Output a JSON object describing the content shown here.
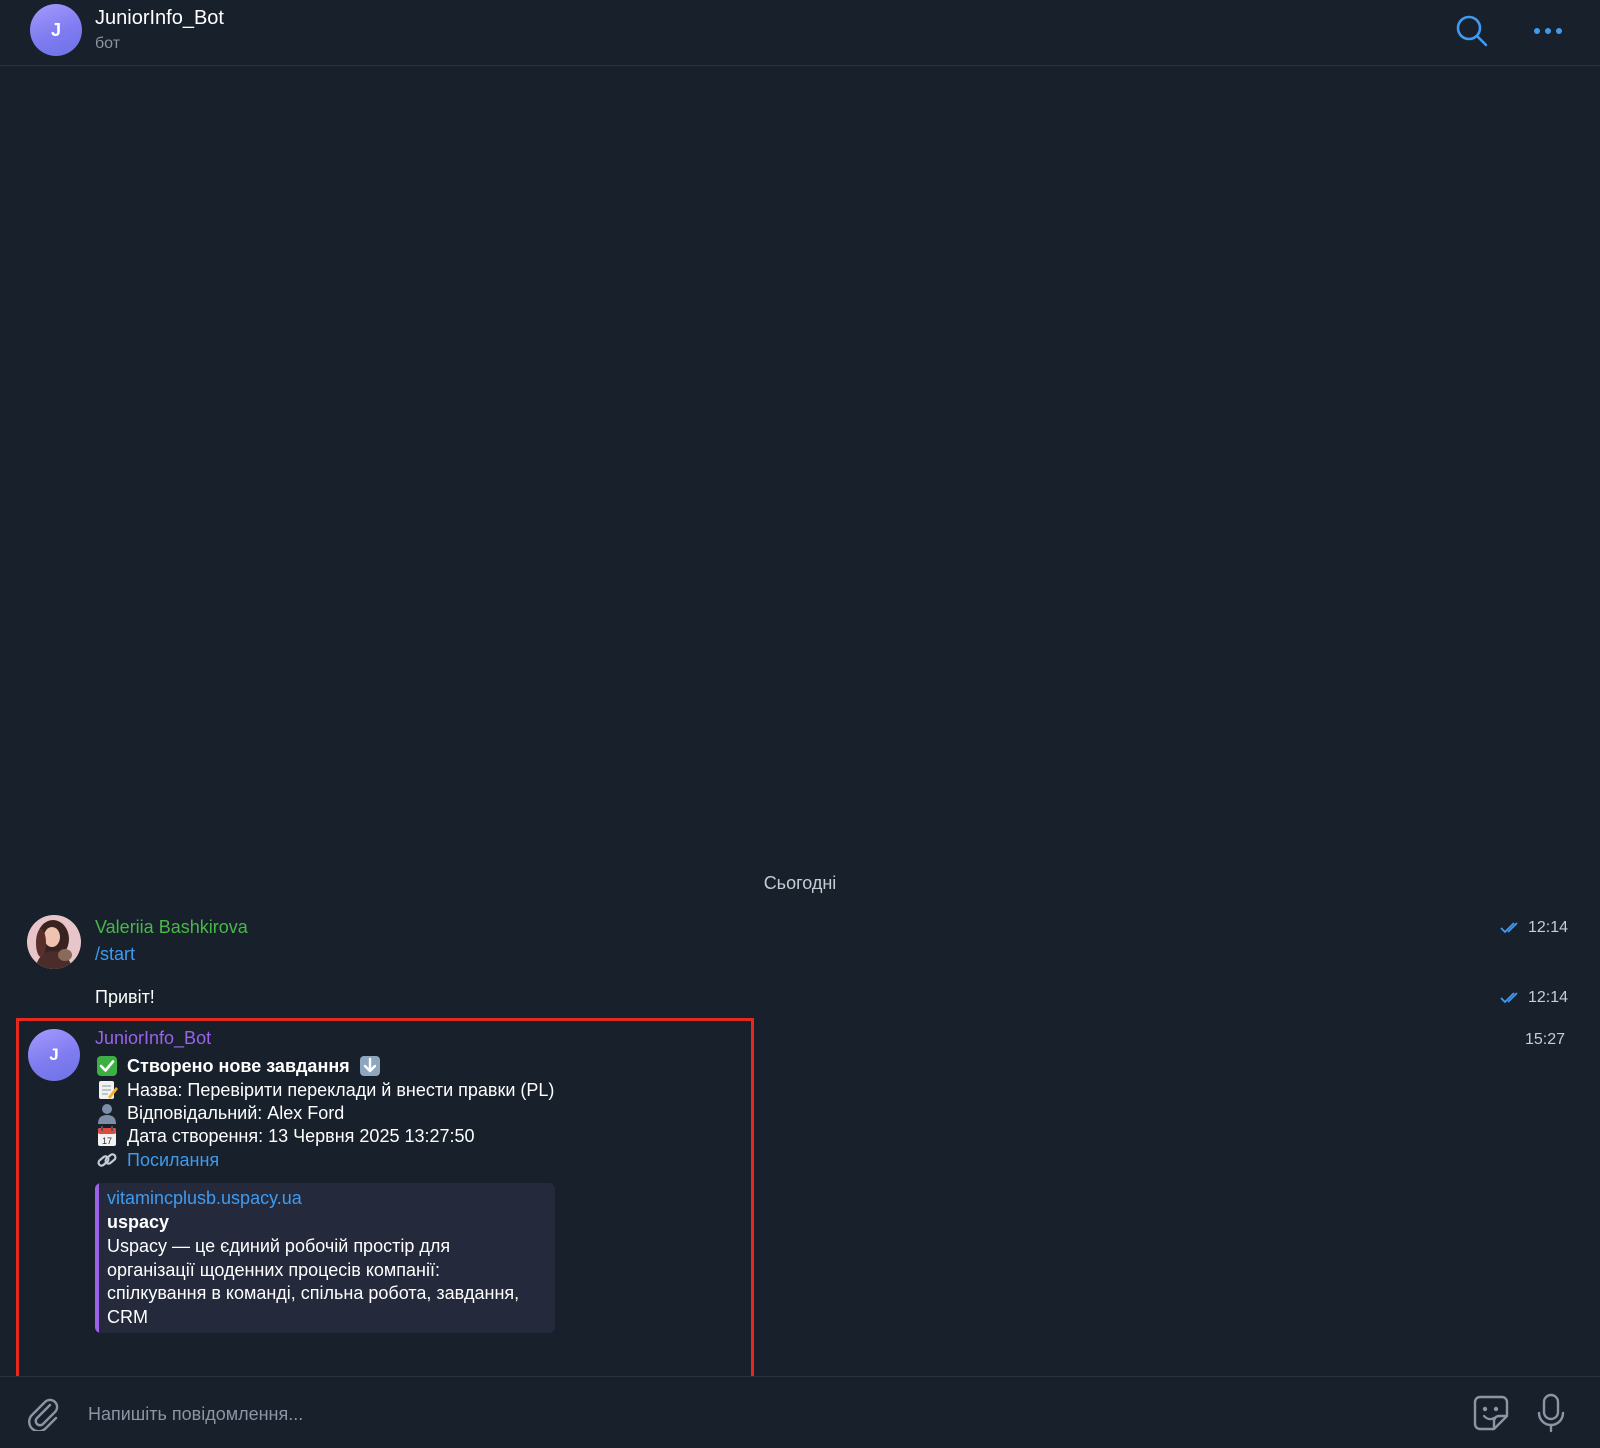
{
  "header": {
    "avatar_letter": "J",
    "title": "JuniorInfo_Bot",
    "subtitle": "бот",
    "search_icon": "search-icon",
    "more_icon": "more-horizontal-icon"
  },
  "chat": {
    "date_separator": "Сьогодні",
    "messages": [
      {
        "sender": "Valeriia Bashkirova",
        "text": "/start",
        "time": "12:14",
        "status": "read"
      },
      {
        "text": "Привіт!",
        "time": "12:14",
        "status": "read"
      },
      {
        "sender": "JuniorInfo_Bot",
        "avatar_letter": "J",
        "time": "15:27",
        "lines": {
          "heading": "Створено нове завдання",
          "name": "Назва: Перевірити переклади й внести правки (PL)",
          "responsible": "Відповідальний: Alex Ford",
          "created": "Дата створення: 13 Червня 2025 13:27:50",
          "link": "Посилання"
        },
        "preview": {
          "domain": "vitamincplusb.uspacy.ua",
          "site_name": "uspacy",
          "description": "Uspacy — це єдиний робочій простір для організації щоденних процесів компанії: спілкування в команді, спільна робота, завдання, CRM"
        }
      }
    ]
  },
  "composer": {
    "placeholder": "Напишіть повідомлення...",
    "attach_icon": "paperclip-icon",
    "sticker_icon": "sticker-icon",
    "mic_icon": "microphone-icon"
  },
  "colors": {
    "background": "#18202b",
    "accent": "#3f9bf0",
    "user_name": "#48b846",
    "bot_name": "#9a63e8",
    "highlight": "#e6281e"
  }
}
